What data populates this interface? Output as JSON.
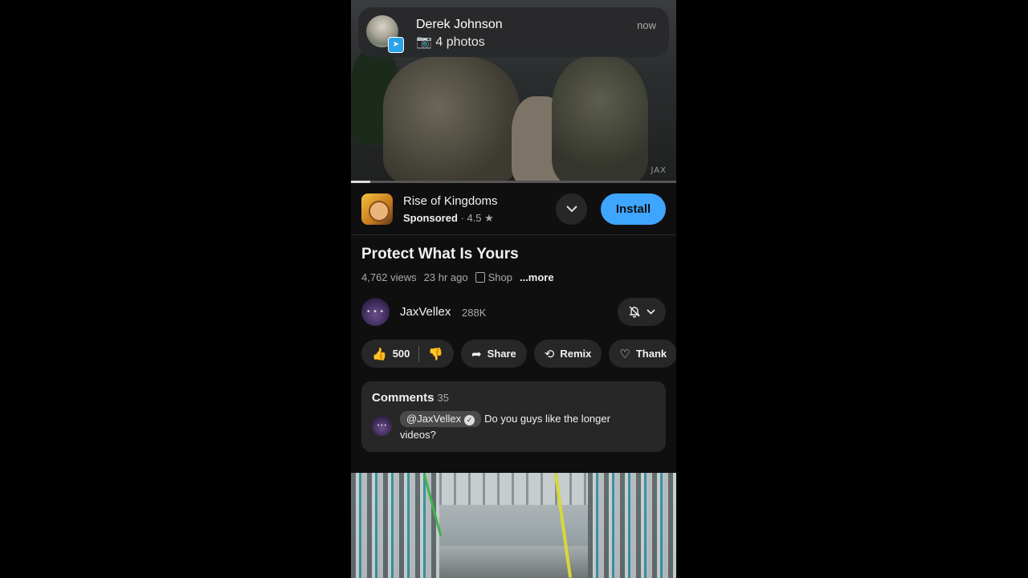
{
  "notification": {
    "sender": "Derek Johnson",
    "message": "📷 4 photos",
    "time": "now",
    "app_badge_icon": "telegram-icon"
  },
  "video": {
    "watermark": "JAX",
    "progress_fraction": 0.06
  },
  "ad": {
    "app_name": "Rise of Kingdoms",
    "sponsored_label": "Sponsored",
    "rating": "4.5",
    "install_label": "Install",
    "accent_color": "#3ea6ff"
  },
  "info": {
    "title": "Protect What Is Yours",
    "views": "4,762 views",
    "age": "23 hr ago",
    "shop_label": "Shop",
    "more_label": "...more"
  },
  "channel": {
    "name": "JaxVellex",
    "subscribers": "288K"
  },
  "actions": {
    "like_count": "500",
    "share_label": "Share",
    "remix_label": "Remix",
    "thanks_label": "Thank"
  },
  "comments": {
    "header": "Comments",
    "count": "35",
    "pinned_author": "@JaxVellex",
    "pinned_text": "Do you guys like the longer videos?"
  }
}
